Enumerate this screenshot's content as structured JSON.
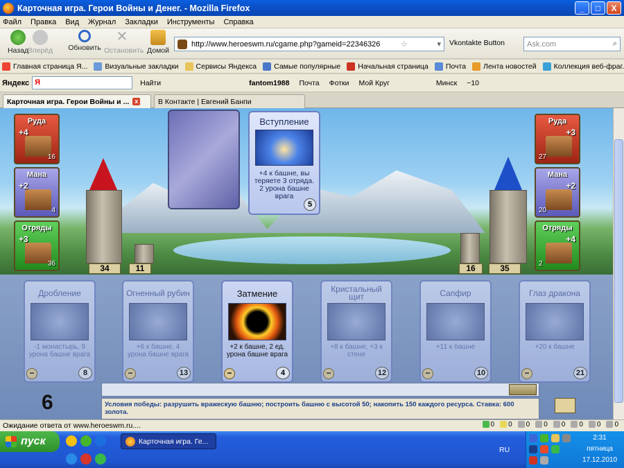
{
  "window": {
    "title": "Карточная игра. Герои Войны и Денег. - Mozilla Firefox",
    "min": "_",
    "max": "□",
    "close": "X"
  },
  "menu": [
    "Файл",
    "Правка",
    "Вид",
    "Журнал",
    "Закладки",
    "Инструменты",
    "Справка"
  ],
  "nav": {
    "back": "Назад",
    "forward": "Вперёд",
    "refresh": "Обновить",
    "stop": "Остановить",
    "home": "Домой",
    "url": "http://www.heroeswm.ru/cgame.php?gameid=22346326",
    "vk_button": "Vkontakte Button",
    "search_placeholder": "Ask.com"
  },
  "bookmarks": [
    "Главная страница Я...",
    "Визуальные закладки",
    "Сервисы Яндекса",
    "Самые популярные",
    "Начальная страница",
    "Почта",
    "Лента новостей",
    "Коллекция веб-фраг..."
  ],
  "yandex": {
    "label": "Яндекс",
    "input_value": "Я",
    "find": "Найти",
    "user": "fantom1988",
    "mail": "Почта",
    "photos": "Фотки",
    "mykrug": "Мой Круг",
    "city": "Минск",
    "temp": "−10"
  },
  "tabs": [
    {
      "label": "Карточная игра. Герои Войны и ...",
      "close": "x"
    },
    {
      "label": "В Контакте | Евгений Банпи"
    }
  ],
  "game": {
    "left_res": [
      {
        "name": "Руда",
        "inc": "+4",
        "amt": "16"
      },
      {
        "name": "Мана",
        "inc": "+2",
        "amt": "4"
      },
      {
        "name": "Отряды",
        "inc": "+3",
        "amt": "36"
      }
    ],
    "right_res": [
      {
        "name": "Руда",
        "inc": "+3",
        "amt": "27"
      },
      {
        "name": "Мана",
        "inc": "+2",
        "amt": "20"
      },
      {
        "name": "Отряды",
        "inc": "+4",
        "amt": "2"
      }
    ],
    "left_tower": "34",
    "left_wall": "11",
    "right_wall": "16",
    "right_tower": "35",
    "played": {
      "title": "Вступление",
      "desc": "+4 к башне, вы теряете 3 отряда. 2 урона башне врага",
      "cost": "5"
    },
    "hand": [
      {
        "title": "Дробление",
        "desc": "-1 монастырь, 9 урона башне врага",
        "cost": "8"
      },
      {
        "title": "Огненный рубин",
        "desc": "+6 к башне, 4 урона башне врага",
        "cost": "13"
      },
      {
        "title": "Затмение",
        "desc": "+2 к башне, 2 ед. урона башне врага",
        "cost": "4"
      },
      {
        "title": "Кристальный щит",
        "desc": "+8 к башне, +3 к стене",
        "cost": "12"
      },
      {
        "title": "Сапфир",
        "desc": "+11 к башне",
        "cost": "10"
      },
      {
        "title": "Глаз дракона",
        "desc": "+20 к башне",
        "cost": "21"
      }
    ],
    "minus": "−",
    "turn": "6",
    "victory": "Условия победы: разрушить вражескую башню; построить башню с высотой 50; накопить 150 каждого ресурса. Ставка: 600 золота."
  },
  "status": {
    "text": "Ожидание ответа от www.heroeswm.ru....",
    "counts": [
      "0",
      "0",
      "0",
      "0",
      "0",
      "0",
      "0",
      "0"
    ]
  },
  "taskbar": {
    "start": "пуск",
    "item": "Карточная игра. Ге...",
    "lang": "RU",
    "time": "2:31",
    "day": "пятница",
    "date": "17.12.2010"
  }
}
